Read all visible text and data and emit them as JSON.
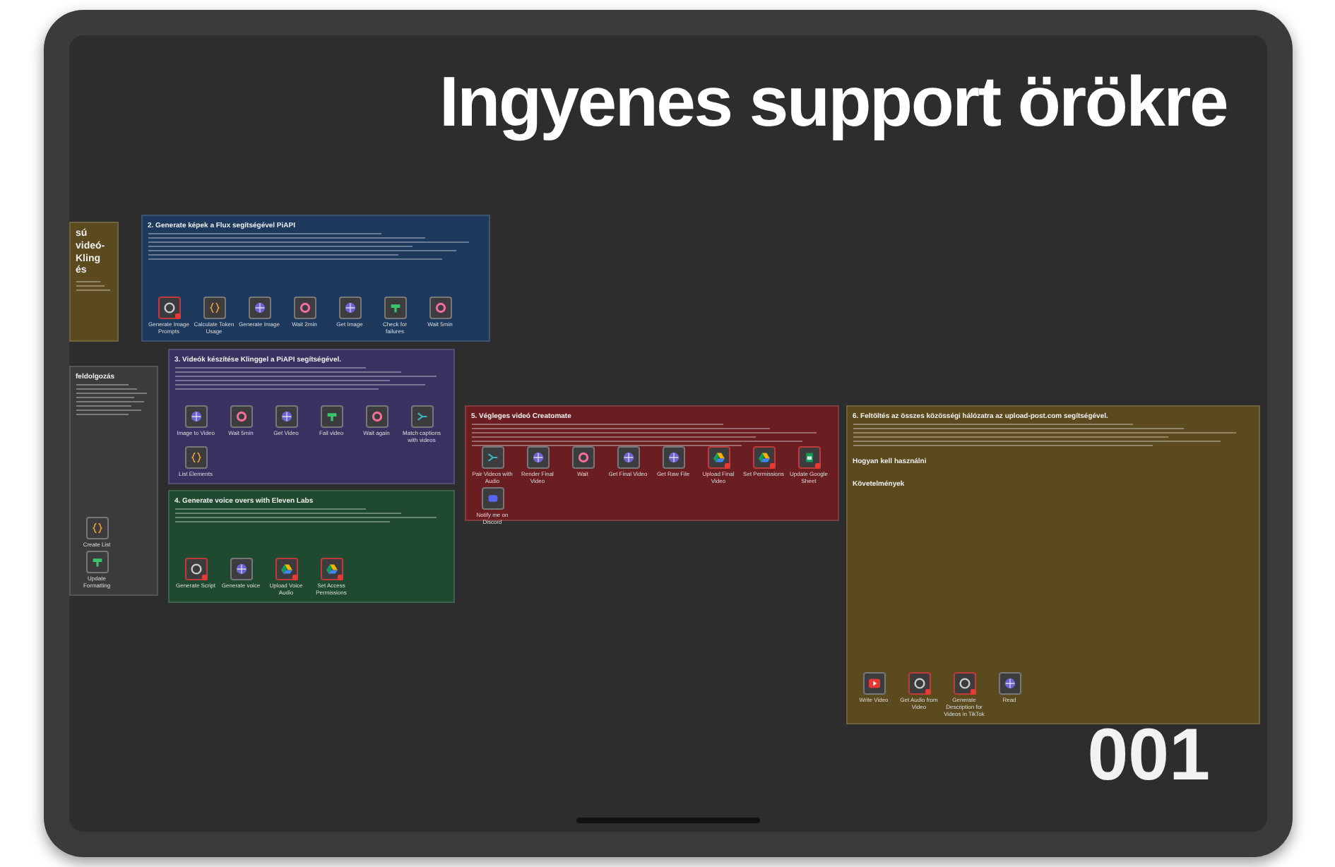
{
  "headline": "Ingyenes support örökre",
  "number": "001",
  "notes": [
    {
      "color": "#5a4a1e",
      "title": "sú videó- Kling és"
    },
    {
      "color": "#1d3a5c",
      "title": "2. Generate képek a Flux segítségével PiAPI",
      "nodes": [
        {
          "kind": "ai",
          "label": "Generate Image Prompts",
          "warning": true
        },
        {
          "kind": "code",
          "label": "Calculate Token Usage",
          "warning": false
        },
        {
          "kind": "http",
          "label": "Generate Image",
          "warning": false
        },
        {
          "kind": "wait",
          "label": "Wait 2min",
          "warning": false
        },
        {
          "kind": "http",
          "label": "Get Image",
          "warning": false
        },
        {
          "kind": "filter",
          "label": "Check for failures",
          "warning": false
        },
        {
          "kind": "wait",
          "label": "Wait 5min",
          "warning": false
        }
      ]
    },
    {
      "color": "#3b3b3d",
      "title": "feldolgozás",
      "nodes": [
        {
          "kind": "code",
          "label": "Create List",
          "warning": false
        },
        {
          "kind": "filter",
          "label": "Update Formatting",
          "warning": false
        }
      ]
    },
    {
      "color": "#3a3160",
      "title": "3. Videók készítése Klinggel a PiAPI segítségével.",
      "nodes": [
        {
          "kind": "http",
          "label": "Image to Video",
          "warning": false
        },
        {
          "kind": "wait",
          "label": "Wait 5min",
          "warning": false
        },
        {
          "kind": "http",
          "label": "Get Video",
          "warning": false
        },
        {
          "kind": "filter",
          "label": "Fail video",
          "warning": false
        },
        {
          "kind": "wait",
          "label": "Wait again",
          "warning": false
        },
        {
          "kind": "merge",
          "label": "Match captions with videos",
          "warning": false
        },
        {
          "kind": "code",
          "label": "List Elements",
          "warning": false
        }
      ]
    },
    {
      "color": "#1f4a30",
      "title": "4. Generate voice overs with Eleven Labs",
      "nodes": [
        {
          "kind": "ai",
          "label": "Generate Script",
          "warning": true
        },
        {
          "kind": "http",
          "label": "Generate voice",
          "warning": false
        },
        {
          "kind": "drive",
          "label": "Upload Voice Audio",
          "warning": true
        },
        {
          "kind": "drive",
          "label": "Set Access Permissions",
          "warning": true
        }
      ]
    },
    {
      "color": "#6b1e22",
      "title": "5. Végleges videó Creatomate",
      "nodes": [
        {
          "kind": "merge",
          "label": "Pair Videos with Audio",
          "warning": false
        },
        {
          "kind": "http",
          "label": "Render Final Video",
          "warning": false
        },
        {
          "kind": "wait",
          "label": "Wait",
          "warning": false
        },
        {
          "kind": "http",
          "label": "Get Final Video",
          "warning": false
        },
        {
          "kind": "http",
          "label": "Get Raw File",
          "warning": false
        },
        {
          "kind": "drive",
          "label": "Upload Final Video",
          "warning": true
        },
        {
          "kind": "drive",
          "label": "Set Permissions",
          "warning": true
        },
        {
          "kind": "sheet",
          "label": "Update Google Sheet",
          "warning": true
        },
        {
          "kind": "discord",
          "label": "Notify me on Discord",
          "warning": false
        }
      ]
    },
    {
      "color": "#5a4a1e",
      "title": "6. Feltöltés az összes közösségi hálózatra az upload-post.com segítségével.",
      "subtitles": [
        "Hogyan kell használni",
        "Követelmények"
      ],
      "nodes": [
        {
          "kind": "youtube",
          "label": "Write Video",
          "warning": false
        },
        {
          "kind": "ai",
          "label": "Get Audio from Video",
          "warning": true
        },
        {
          "kind": "ai",
          "label": "Generate Description for Videos in TikTok",
          "warning": true
        },
        {
          "kind": "http",
          "label": "Read",
          "warning": false
        }
      ]
    }
  ]
}
